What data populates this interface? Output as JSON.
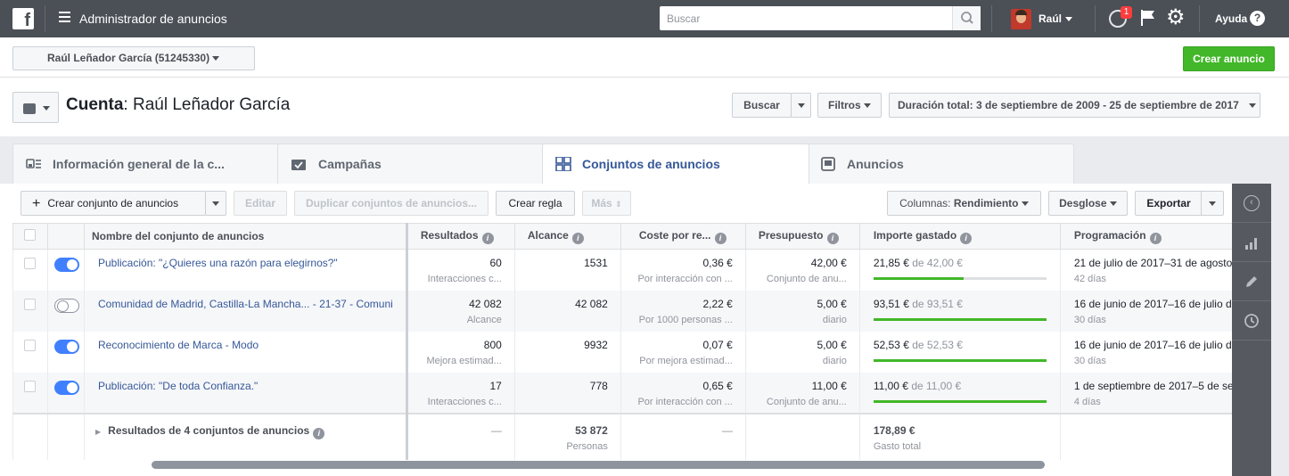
{
  "topbar": {
    "logo": "f",
    "app_title": "Administrador de anuncios",
    "search_placeholder": "Buscar",
    "user_name": "Raúl",
    "notification_count": "1",
    "help_label": "Ayuda",
    "icons": [
      "facebook-logo",
      "menu-icon",
      "search-icon",
      "globe-icon",
      "flag-icon",
      "gear-icon",
      "help-icon"
    ]
  },
  "account_bar": {
    "account_selector": "Raúl Leñador García (51245330)",
    "create_ad_label": "Crear anuncio"
  },
  "header": {
    "cuenta_label": "Cuenta",
    "account_name": "Raúl Leñador García",
    "search_label": "Buscar",
    "filters_label": "Filtros",
    "date_range": "Duración total: 3 de septiembre de 2009 - 25 de septiembre de 2017"
  },
  "tabs": [
    {
      "label": "Información general de la c...",
      "icon": "account-overview-icon"
    },
    {
      "label": "Campañas",
      "icon": "campaign-folder-icon"
    },
    {
      "label": "Conjuntos de anuncios",
      "icon": "grid-icon",
      "active": true
    },
    {
      "label": "Anuncios",
      "icon": "ad-icon"
    }
  ],
  "toolbar": {
    "create_adset": "Crear conjunto de anuncios",
    "edit": "Editar",
    "duplicate": "Duplicar conjuntos de anuncios...",
    "create_rule": "Crear regla",
    "more": "Más",
    "columns_prefix": "Columnas: ",
    "columns_value": "Rendimiento",
    "breakdown": "Desglose",
    "export": "Exportar"
  },
  "table": {
    "headers": {
      "name": "Nombre del conjunto de anuncios",
      "results": "Resultados",
      "reach": "Alcance",
      "cost": "Coste por re...",
      "budget": "Presupuesto",
      "spent": "Importe gastado",
      "schedule": "Programación"
    },
    "rows": [
      {
        "on": true,
        "name": "Publicación: \"¿Quieres una razón para elegirnos?\"",
        "results": "60",
        "results_sub": "Interacciones c...",
        "reach": "1531",
        "cost": "0,36 €",
        "cost_sub": "Por interacción con ...",
        "budget": "42,00 €",
        "budget_sub": "Conjunto de anu...",
        "spent": "21,85 €",
        "spent_of": "de 42,00 €",
        "spent_progress": 0.52,
        "schedule": "21 de julio de 2017–31 de agosto de",
        "schedule_sub": "42 días"
      },
      {
        "on": false,
        "name": "Comunidad de Madrid, Castilla-La Mancha... - 21-37 - Comuni",
        "results": "42 082",
        "results_sub": "Alcance",
        "reach": "42 082",
        "cost": "2,22 €",
        "cost_sub": "Por 1000 personas ...",
        "budget": "5,00 €",
        "budget_sub": "diario",
        "spent": "93,51 €",
        "spent_of": "de 93,51 €",
        "spent_progress": 1.0,
        "schedule": "16 de junio de 2017–16 de julio de 2",
        "schedule_sub": "30 días"
      },
      {
        "on": true,
        "name": "Reconocimiento de Marca - Modo",
        "results": "800",
        "results_sub": "Mejora estimad...",
        "reach": "9932",
        "cost": "0,07 €",
        "cost_sub": "Por mejora estimad...",
        "budget": "5,00 €",
        "budget_sub": "diario",
        "spent": "52,53 €",
        "spent_of": "de 52,53 €",
        "spent_progress": 1.0,
        "schedule": "16 de junio de 2017–16 de julio de 2",
        "schedule_sub": "30 días"
      },
      {
        "on": true,
        "name": "Publicación: \"De toda Confianza.\"",
        "results": "17",
        "results_sub": "Interacciones c...",
        "reach": "778",
        "cost": "0,65 €",
        "cost_sub": "Por interacción con ...",
        "budget": "11,00 €",
        "budget_sub": "Conjunto de anu...",
        "spent": "11,00 €",
        "spent_of": "de 11,00 €",
        "spent_progress": 1.0,
        "schedule": "1 de septiembre de 2017–5 de sept",
        "schedule_sub": "4 días"
      }
    ],
    "total": {
      "label": "Resultados de 4 conjuntos de anuncios",
      "results": "—",
      "reach": "53 872",
      "reach_sub": "Personas",
      "cost": "—",
      "spent": "178,89 €",
      "spent_sub": "Gasto total"
    }
  },
  "colors": {
    "topbar": "#4b4f56",
    "link": "#365899",
    "green": "#42b72a",
    "toggle_on": "#4080ff",
    "rail": "#56595f"
  }
}
